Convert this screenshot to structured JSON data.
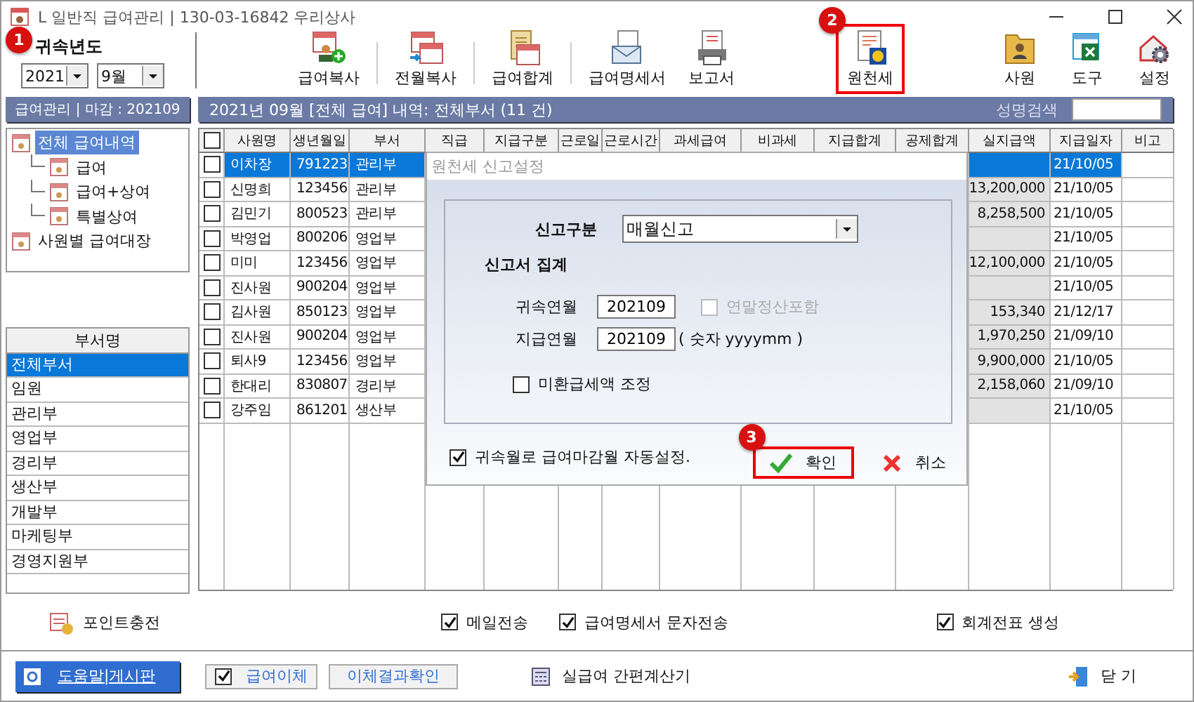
{
  "window": {
    "title": "L 일반직 급여관리 | 130-03-16842  우리상사"
  },
  "period": {
    "callout": "1",
    "label": "귀속년도",
    "year": "2021",
    "month": "9월"
  },
  "toolbar": [
    {
      "label": "급여복사",
      "highlighted": false
    },
    {
      "label": "전월복사",
      "highlighted": false
    },
    {
      "label": "급여합계",
      "highlighted": false
    },
    {
      "label": "급여명세서",
      "highlighted": false
    },
    {
      "label": "보고서",
      "highlighted": false
    },
    {
      "label": "원천세",
      "highlighted": true,
      "callout": "2"
    }
  ],
  "toolbar_right": [
    {
      "label": "사원"
    },
    {
      "label": "도구"
    },
    {
      "label": "설정"
    }
  ],
  "left_header": "급여관리 | 마감 : 202109",
  "tree": [
    {
      "label": "전체 급여내역",
      "selected": true,
      "children": [
        {
          "label": "급여",
          "selected": false
        },
        {
          "label": "급여+상여",
          "selected": false
        },
        {
          "label": "특별상여",
          "selected": false
        }
      ]
    },
    {
      "label": "사원별 급여대장",
      "selected": false
    }
  ],
  "departments": {
    "header": "부서명",
    "items": [
      {
        "label": "전체부서",
        "selected": true
      },
      {
        "label": "임원",
        "selected": false
      },
      {
        "label": "관리부",
        "selected": false
      },
      {
        "label": "영업부",
        "selected": false
      },
      {
        "label": "경리부",
        "selected": false
      },
      {
        "label": "생산부",
        "selected": false
      },
      {
        "label": "개발부",
        "selected": false
      },
      {
        "label": "마케팅부",
        "selected": false
      },
      {
        "label": "경영지원부",
        "selected": false
      }
    ]
  },
  "grid": {
    "caption": "2021년 09월 [전체 급여] 내역: 전체부서 (11 건)",
    "search_label": "성명검색",
    "all_checked": false,
    "columns": [
      "사원명",
      "생년월일",
      "부서",
      "직급",
      "지급구분",
      "근로일",
      "근로시간",
      "과세급여",
      "비과세",
      "지급합계",
      "공제합계",
      "실지급액",
      "지급일자",
      "비고"
    ],
    "rows": [
      {
        "checked": false,
        "selected": true,
        "name": "이차장",
        "birth": "791223",
        "dept": "관리부",
        "pay_date": "21/10/05"
      },
      {
        "checked": false,
        "selected": false,
        "name": "신명희",
        "birth": "123456",
        "dept": "관리부",
        "net_pay": "13,200,000",
        "pay_date": "21/10/05"
      },
      {
        "checked": false,
        "selected": false,
        "name": "김민기",
        "birth": "800523",
        "dept": "관리부",
        "net_pay": "8,258,500",
        "pay_date": "21/10/05"
      },
      {
        "checked": false,
        "selected": false,
        "name": "박영업",
        "birth": "800206",
        "dept": "영업부",
        "pay_date": "21/10/05"
      },
      {
        "checked": false,
        "selected": false,
        "name": "미미",
        "birth": "123456",
        "dept": "영업부",
        "net_pay": "12,100,000",
        "pay_date": "21/10/05"
      },
      {
        "checked": false,
        "selected": false,
        "name": "진사원",
        "birth": "900204",
        "dept": "영업부",
        "pay_date": "21/10/05"
      },
      {
        "checked": false,
        "selected": false,
        "name": "김사원",
        "birth": "850123",
        "dept": "영업부",
        "net_pay": "153,340",
        "pay_date": "21/12/17"
      },
      {
        "checked": false,
        "selected": false,
        "name": "진사원",
        "birth": "900204",
        "dept": "영업부",
        "net_pay": "1,970,250",
        "pay_date": "21/09/10"
      },
      {
        "checked": false,
        "selected": false,
        "name": "퇴사9",
        "birth": "123456",
        "dept": "영업부",
        "net_pay": "9,900,000",
        "pay_date": "21/10/05"
      },
      {
        "checked": false,
        "selected": false,
        "name": "한대리",
        "birth": "830807",
        "dept": "경리부",
        "net_pay": "2,158,060",
        "pay_date": "21/09/10"
      },
      {
        "checked": false,
        "selected": false,
        "name": "강주임",
        "birth": "861201",
        "dept": "생산부",
        "pay_date": "21/10/05"
      }
    ]
  },
  "dialog": {
    "title": "원천세 신고설정",
    "report_type_label": "신고구분",
    "report_type": "매월신고",
    "section": "신고서 집계",
    "fields": [
      {
        "label": "귀속연월",
        "value": "202109"
      },
      {
        "label": "지급연월",
        "value": "202109"
      }
    ],
    "year_end": {
      "label": "연말정산포함",
      "checked": false,
      "disabled": true
    },
    "format_hint": "( 숫자 yyyymm )",
    "refund_adjust": {
      "label": "미환급세액 조정",
      "checked": false
    },
    "auto_close": {
      "label": "귀속월로 급여마감월 자동설정.",
      "checked": true
    },
    "confirm": {
      "label": "확인",
      "callout": "3",
      "highlighted": true
    },
    "cancel": {
      "label": "취소"
    }
  },
  "point": "포인트충전",
  "options": [
    {
      "label": "메일전송",
      "checked": true
    },
    {
      "label": "급여명세서 문자전송",
      "checked": true
    },
    {
      "label": "회계전표 생성",
      "checked": true
    }
  ],
  "footer": {
    "help": "도움말|게시판",
    "transfer": {
      "label": "급여이체",
      "checked": true
    },
    "transfer_result": "이체결과확인",
    "calculator": "실급여 간편계산기",
    "close": "닫 기"
  }
}
